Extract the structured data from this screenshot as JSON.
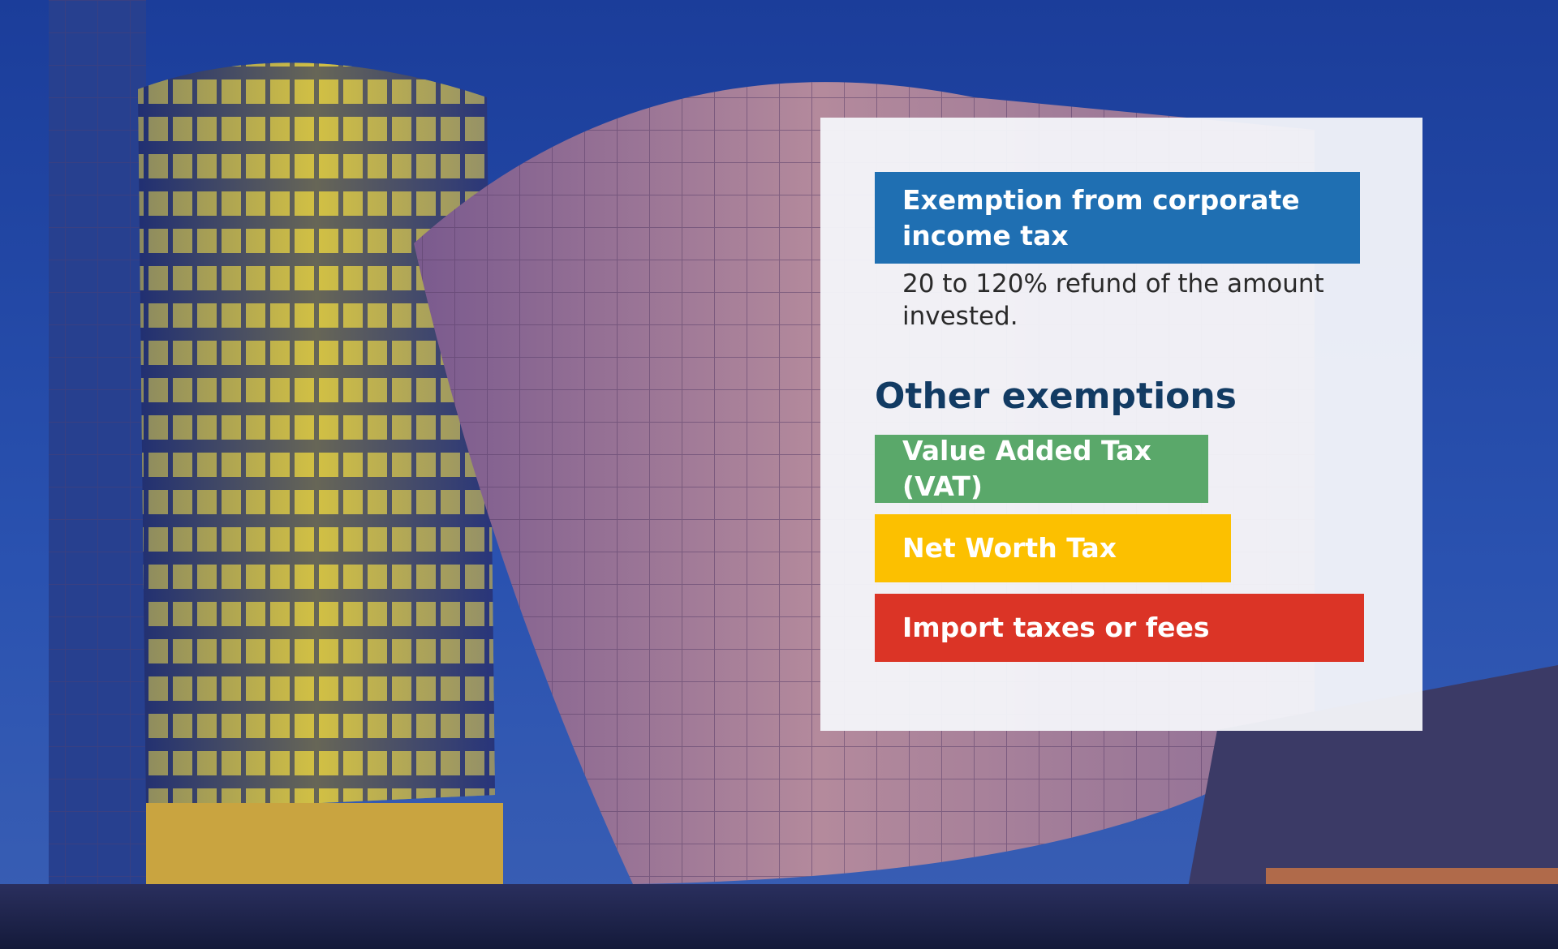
{
  "card": {
    "primary_title": "Exemption from corporate income tax",
    "primary_desc": "20 to 120% refund of the amount invested.",
    "other_heading": "Other exemptions",
    "items": [
      {
        "label": "Value Added Tax (VAT)",
        "color": "#5aa86a"
      },
      {
        "label": "Net Worth Tax",
        "color": "#fcc000"
      },
      {
        "label": "Import taxes or fees",
        "color": "#db3426"
      }
    ],
    "primary_color": "#1f6fb2",
    "heading_color": "#123b63"
  }
}
